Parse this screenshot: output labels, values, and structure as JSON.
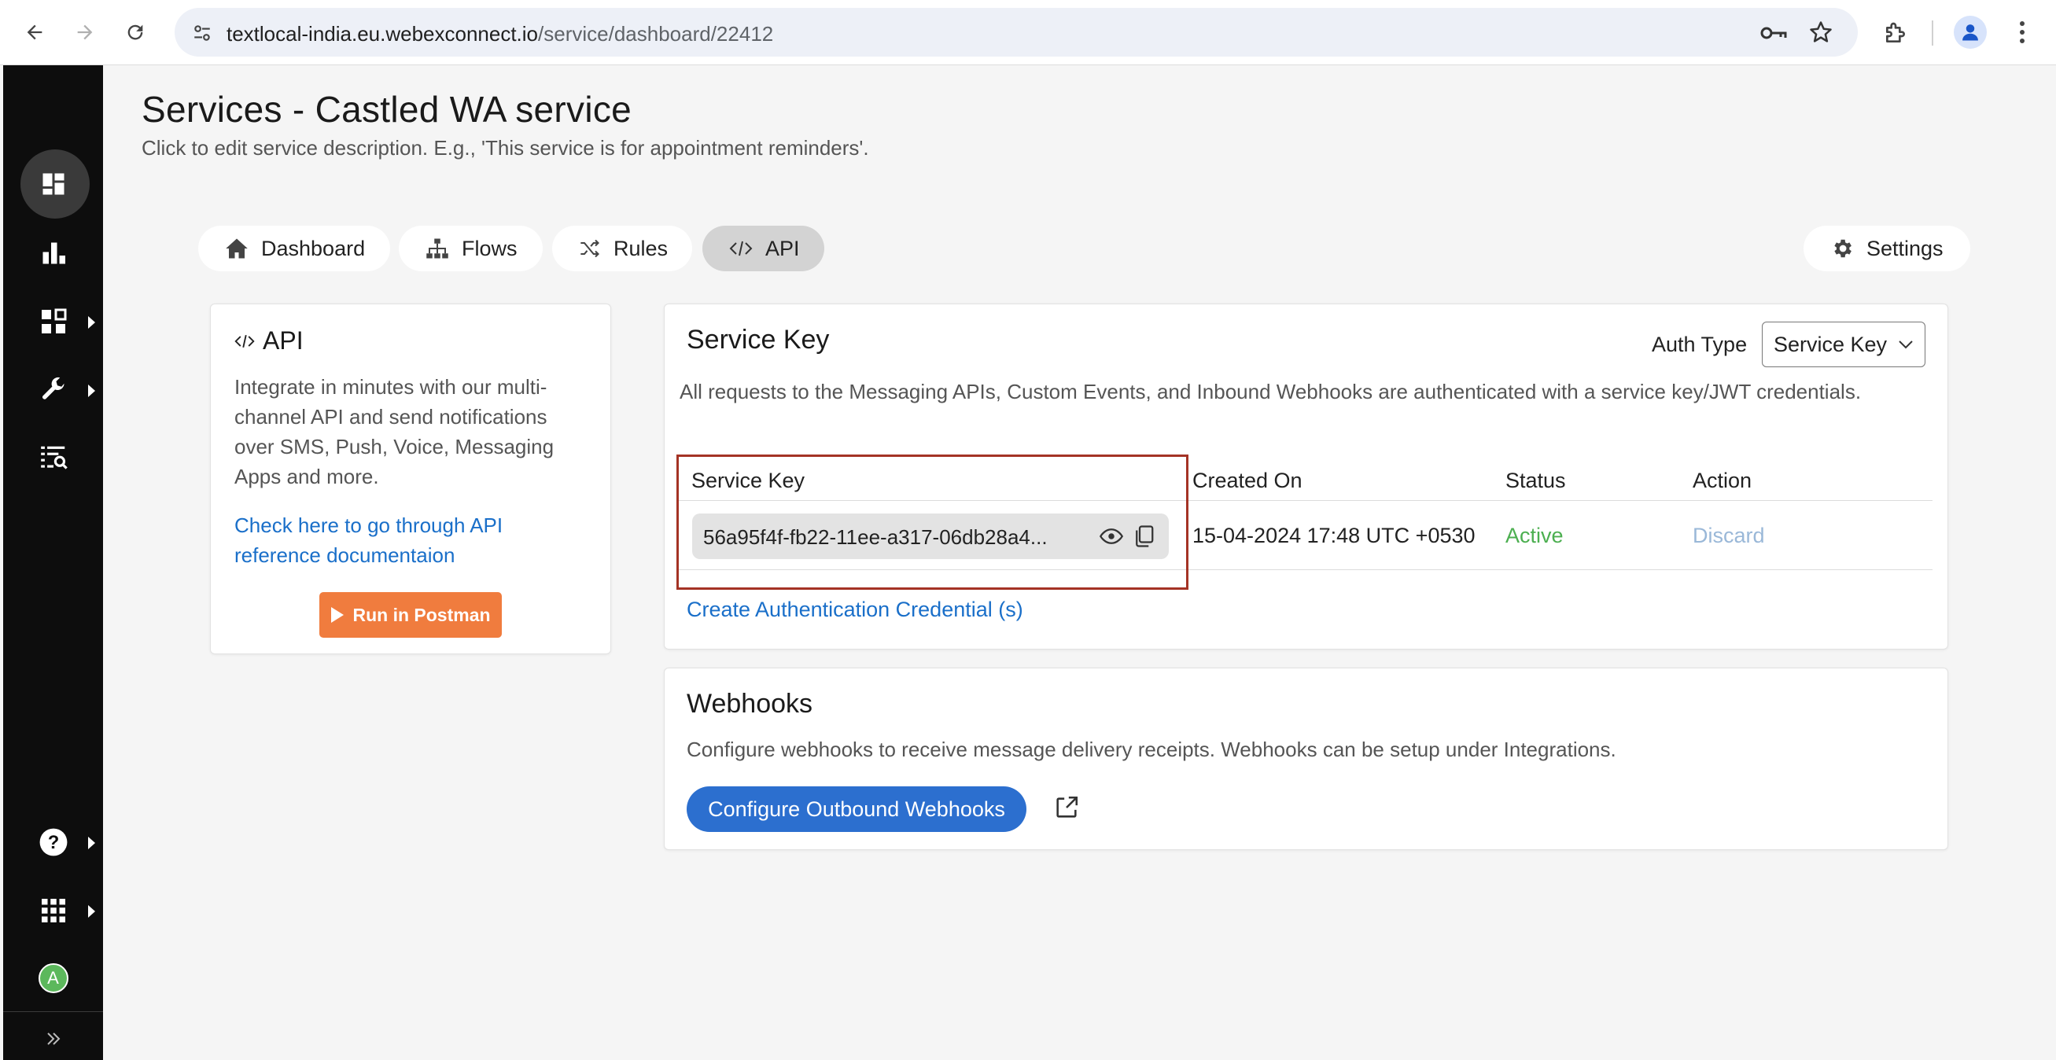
{
  "browser": {
    "url_host": "textlocal-india.eu.webexconnect.io",
    "url_path": "/service/dashboard/22412"
  },
  "page": {
    "title": "Services - Castled WA service",
    "description": "Click to edit service description. E.g., 'This service is for appointment reminders'."
  },
  "tabs": [
    {
      "label": "Dashboard",
      "icon": "home-icon"
    },
    {
      "label": "Flows",
      "icon": "flows-icon"
    },
    {
      "label": "Rules",
      "icon": "shuffle-icon"
    },
    {
      "label": "API",
      "icon": "code-icon",
      "active": true
    }
  ],
  "settings_label": "Settings",
  "api_card": {
    "title": "API",
    "description": "Integrate in minutes with our multi-channel API and send notifications over SMS, Push, Voice, Messaging Apps and more.",
    "link": "Check here to go through API reference documentaion",
    "postman_button": "Run in Postman"
  },
  "service_key_card": {
    "title": "Service Key",
    "auth_type_label": "Auth Type",
    "auth_type_value": "Service Key",
    "description": "All requests to the Messaging APIs, Custom Events, and Inbound Webhooks are authenticated with a service key/JWT credentials.",
    "columns": [
      "Service Key",
      "Created On",
      "Status",
      "Action"
    ],
    "row": {
      "key": "56a95f4f-fb22-11ee-a317-06db28a4...",
      "created_on": "15-04-2024 17:48 UTC +0530",
      "status": "Active",
      "action": "Discard"
    },
    "create_link": "Create Authentication Credential (s)"
  },
  "webhooks_card": {
    "title": "Webhooks",
    "description": "Configure webhooks to receive message delivery receipts. Webhooks can be setup under Integrations.",
    "button": "Configure Outbound Webhooks"
  },
  "sidebar": {
    "avatar_letter": "A"
  },
  "colors": {
    "link_blue": "#1a6fc9",
    "status_active": "#4caf50",
    "discard": "#9ab8d8",
    "postman_orange": "#f07c3e",
    "highlight_red": "#a43325"
  }
}
